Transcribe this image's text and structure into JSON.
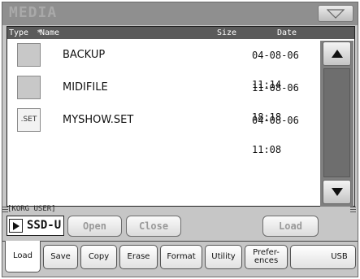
{
  "window": {
    "title": "MEDIA"
  },
  "list": {
    "columns": {
      "type": "Type",
      "sort_marker": "*",
      "name": "Name",
      "size": "Size",
      "date": "Date"
    },
    "rows": [
      {
        "icon": "folder-icon",
        "icon_label": "",
        "name": "BACKUP",
        "size": "",
        "date": "04-08-06 11:14"
      },
      {
        "icon": "folder-icon",
        "icon_label": "",
        "name": "MIDIFILE",
        "size": "",
        "date": "11-08-06 18:18"
      },
      {
        "icon": "set-file-icon",
        "icon_label": ".SET",
        "name": "MYSHOW.SET",
        "size": "",
        "date": "04-08-06 11:08"
      }
    ]
  },
  "path": {
    "text": "[KORG USER]"
  },
  "device": {
    "label": "SSD-U"
  },
  "buttons": {
    "open": "Open",
    "close": "Close",
    "load": "Load"
  },
  "tabs": {
    "load": "Load",
    "save": "Save",
    "copy": "Copy",
    "erase": "Erase",
    "format": "Format",
    "utility": "Utility",
    "preferences": "Prefer-\nences",
    "usb": "USB"
  },
  "colors": {
    "title_bar": "#8f8f8f",
    "header": "#5a5a5a",
    "panel": "#c6c6c6",
    "disabled_text": "#9a9a9a"
  }
}
